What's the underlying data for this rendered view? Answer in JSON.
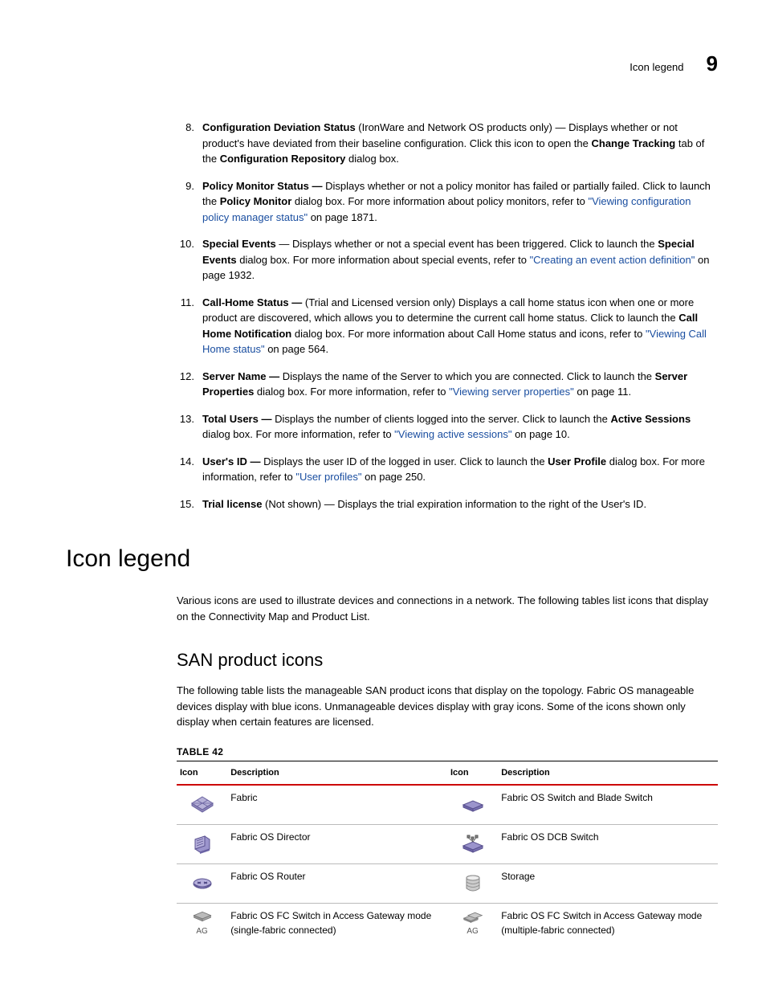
{
  "header": {
    "label": "Icon legend",
    "chapter": "9"
  },
  "items": [
    {
      "num": "8.",
      "runs": [
        {
          "t": "Configuration Deviation Status ",
          "b": true
        },
        {
          "t": "(IronWare and Network OS products only) — Displays whether or not product's have deviated from their baseline configuration. Click this icon to open the "
        },
        {
          "t": "Change Tracking",
          "b": true
        },
        {
          "t": " tab of the "
        },
        {
          "t": "Configuration Repository",
          "b": true
        },
        {
          "t": " dialog box."
        }
      ]
    },
    {
      "num": "9.",
      "runs": [
        {
          "t": "Policy Monitor Status — ",
          "b": true
        },
        {
          "t": "Displays whether or not a policy monitor has failed or partially failed. Click to launch the "
        },
        {
          "t": "Policy Monitor",
          "b": true
        },
        {
          "t": " dialog box. For more information about policy monitors, refer to "
        },
        {
          "t": "\"Viewing configuration policy manager status\"",
          "link": true
        },
        {
          "t": " on page 1871."
        }
      ]
    },
    {
      "num": "10.",
      "runs": [
        {
          "t": "Special Events",
          "b": true
        },
        {
          "t": " — Displays whether or not a special event has been triggered. Click to launch the "
        },
        {
          "t": "Special Events",
          "b": true
        },
        {
          "t": " dialog box. For more information about special events, refer to "
        },
        {
          "t": "\"Creating an event action definition\"",
          "link": true
        },
        {
          "t": " on page 1932."
        }
      ]
    },
    {
      "num": "11.",
      "runs": [
        {
          "t": "Call-Home Status — ",
          "b": true
        },
        {
          "t": "(Trial and Licensed version only) Displays a call home status icon when one or more product are discovered, which allows you to determine the current call home status. Click to launch the "
        },
        {
          "t": "Call Home Notification",
          "b": true
        },
        {
          "t": " dialog box. For more information about Call Home status and icons, refer to "
        },
        {
          "t": "\"Viewing Call Home status\"",
          "link": true
        },
        {
          "t": " on page 564."
        }
      ]
    },
    {
      "num": "12.",
      "runs": [
        {
          "t": "Server Name — ",
          "b": true
        },
        {
          "t": "Displays the name of the Server to which you are connected. Click to launch the "
        },
        {
          "t": "Server Properties",
          "b": true
        },
        {
          "t": " dialog box. For more information, refer to "
        },
        {
          "t": "\"Viewing server properties\"",
          "link": true
        },
        {
          "t": " on page 11."
        }
      ]
    },
    {
      "num": "13.",
      "runs": [
        {
          "t": "Total Users — ",
          "b": true
        },
        {
          "t": "Displays the number of clients logged into the server. Click to launch the "
        },
        {
          "t": "Active Sessions",
          "b": true
        },
        {
          "t": " dialog box. For more information, refer to "
        },
        {
          "t": "\"Viewing active sessions\"",
          "link": true
        },
        {
          "t": " on page 10."
        }
      ]
    },
    {
      "num": "14.",
      "runs": [
        {
          "t": "User's ID — ",
          "b": true
        },
        {
          "t": "Displays the user ID of the logged in user. Click to launch the "
        },
        {
          "t": "User Profile",
          "b": true
        },
        {
          "t": " dialog box. For more information, refer to "
        },
        {
          "t": "\"User profiles\"",
          "link": true
        },
        {
          "t": " on page 250."
        }
      ]
    },
    {
      "num": "15.",
      "runs": [
        {
          "t": "Trial license ",
          "b": true
        },
        {
          "t": "(Not shown) — Displays the trial expiration information to the right of the User's ID."
        }
      ]
    }
  ],
  "section": {
    "title": "Icon legend",
    "intro": "Various icons are used to illustrate devices and connections in a network. The following tables list icons that display on the Connectivity Map and Product List."
  },
  "subsection": {
    "title": "SAN product icons",
    "intro": "The following table lists the manageable SAN product icons that display on the topology. Fabric OS manageable devices display with blue icons. Unmanageable devices display with gray icons. Some of the icons shown only display when certain features are licensed."
  },
  "table": {
    "label": "TABLE 42",
    "headers": [
      "Icon",
      "Description",
      "Icon",
      "Description"
    ],
    "rows": [
      {
        "left": {
          "icon": "fabric",
          "desc": "Fabric"
        },
        "right": {
          "icon": "switch",
          "desc": "Fabric OS Switch and Blade Switch"
        }
      },
      {
        "left": {
          "icon": "director",
          "desc": "Fabric OS Director"
        },
        "right": {
          "icon": "dcb-switch",
          "desc": "Fabric OS DCB Switch"
        }
      },
      {
        "left": {
          "icon": "router",
          "desc": "Fabric OS Router"
        },
        "right": {
          "icon": "storage",
          "desc": "Storage"
        }
      },
      {
        "left": {
          "icon": "ag-single",
          "ag": "AG",
          "desc": "Fabric OS FC Switch in Access Gateway mode (single-fabric connected)"
        },
        "right": {
          "icon": "ag-multi",
          "ag": "AG",
          "desc": "Fabric OS FC Switch in Access Gateway mode (multiple-fabric connected)"
        }
      }
    ]
  }
}
